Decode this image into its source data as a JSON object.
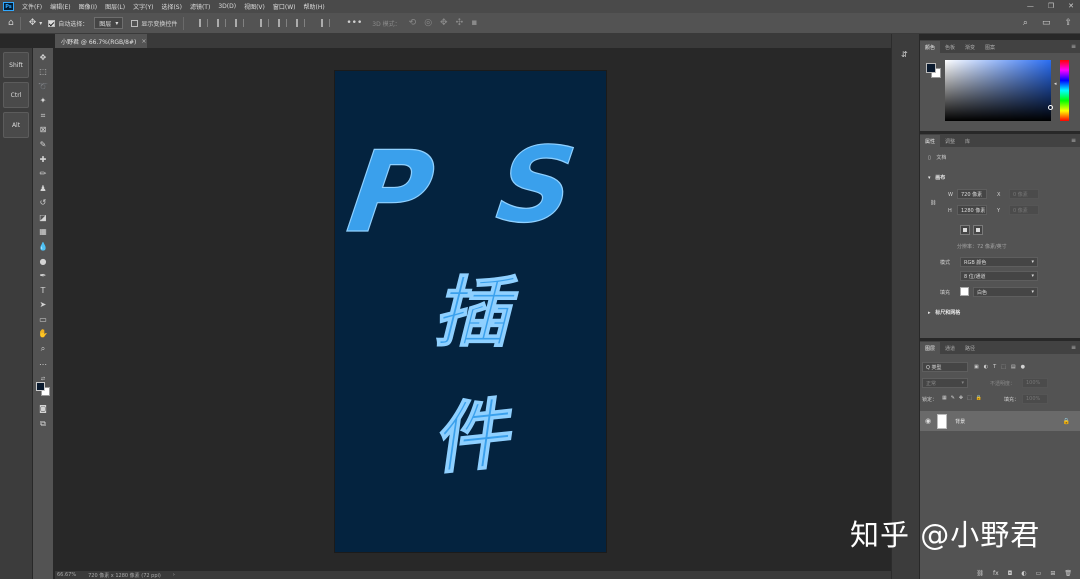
{
  "menubar": {
    "items": [
      "文件(F)",
      "编辑(E)",
      "图像(I)",
      "图层(L)",
      "文字(Y)",
      "选择(S)",
      "滤镜(T)",
      "3D(D)",
      "视图(V)",
      "窗口(W)",
      "帮助(H)"
    ],
    "app_logo": "Ps",
    "window_controls": [
      "—",
      "❐",
      "✕"
    ]
  },
  "options": {
    "auto_select_label": "自动选择：",
    "auto_select_value": "图层",
    "show_transform_label": "显示变换控件",
    "mode_3d_label": "3D 模式："
  },
  "document_tab": {
    "title": "小野君 @ 66.7%(RGB/8#)",
    "close": "×"
  },
  "modifier_keys": [
    "Shift",
    "Ctrl",
    "Alt"
  ],
  "canvas": {
    "background": "#04233f",
    "text_color": "#3aa0ec",
    "line1": [
      "P",
      "S"
    ],
    "line2": "插",
    "line3": "件"
  },
  "status": {
    "zoom": "66.67%",
    "doc_info": "720 像素 x 1280 像素 (72 ppi)"
  },
  "color_panel": {
    "tabs": [
      "颜色",
      "色板",
      "渐变",
      "图案"
    ]
  },
  "properties_panel": {
    "tabs": [
      "属性",
      "调整",
      "库"
    ],
    "kind": "文档",
    "canvas_section": "画布",
    "w_label": "W",
    "w_value": "720 像素",
    "x_label": "X",
    "x_placeholder": "0 像素",
    "h_label": "H",
    "h_value": "1280 像素",
    "y_label": "Y",
    "y_placeholder": "0 像素",
    "resolution": "分辨率：72 像素/英寸",
    "mode_label": "模式",
    "mode_value": "RGB 颜色",
    "depth_value": "8 位/通道",
    "fill_label": "填充",
    "fill_value": "白色",
    "rulers_section": "标尺和网格"
  },
  "layers_panel": {
    "tabs": [
      "图层",
      "通道",
      "路径"
    ],
    "filter_placeholder": "Q 类型",
    "blend_mode": "正常",
    "opacity_label": "不透明度：",
    "opacity_value": "100%",
    "lock_label": "锁定：",
    "fill_label": "填充：",
    "fill_value": "100%",
    "layer_name": "背景"
  },
  "watermark": "知乎 @小野君",
  "colors": {
    "accent": "#31a8ff",
    "panel_bg": "#535353",
    "workspace": "#282828"
  }
}
